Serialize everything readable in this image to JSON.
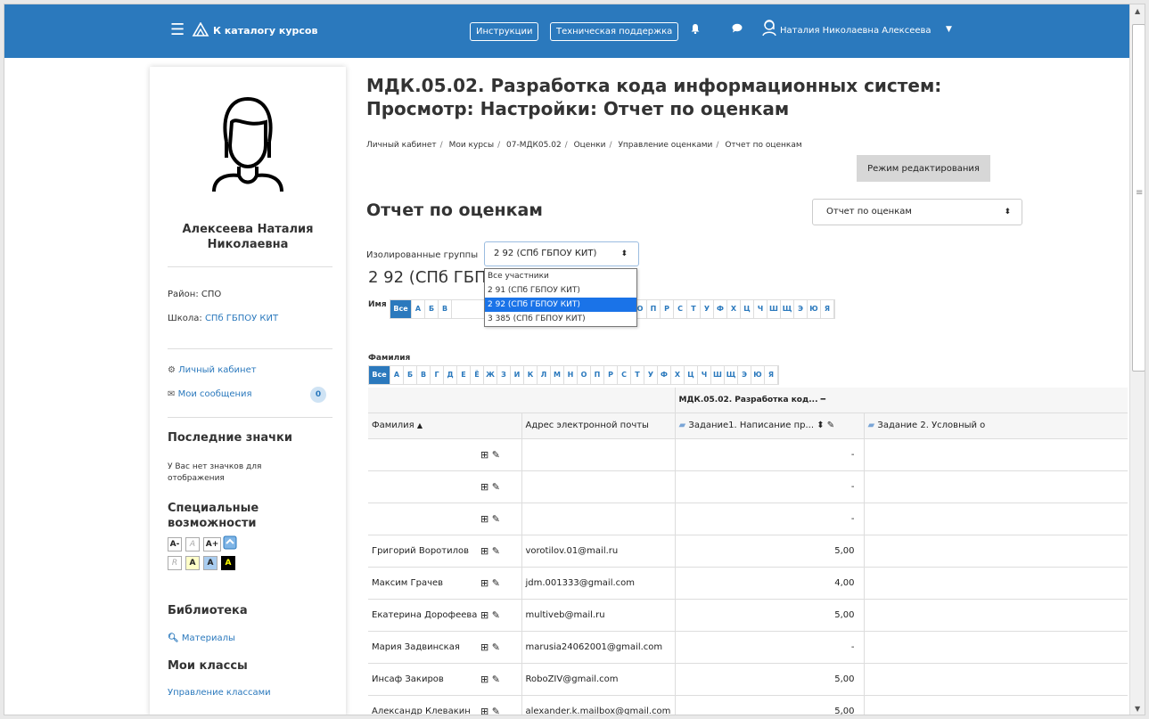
{
  "navbar": {
    "catalog_label": "К каталогу курсов",
    "instructions_label": "Инструкции",
    "support_label": "Техническая поддержка",
    "user_name": "Наталия Николаевна Алексеева",
    "bg_color": "#2b79bd"
  },
  "sidebar": {
    "profile_name": "Алексеева Наталия Николаевна",
    "district_label": "Район:",
    "district_value": "СПО",
    "school_label": "Школа:",
    "school_value": "СПб ГБПОУ КИТ",
    "dashboard_link": "Личный кабинет",
    "messages_link": "Мои сообщения",
    "messages_count": "0",
    "badges_heading": "Последние значки",
    "badges_empty": "У Вас нет значков для отображения",
    "accessibility_heading": "Специальные возможности",
    "accessibility_buttons": [
      "A-",
      "A",
      "A+",
      "R",
      "A",
      "A",
      "A"
    ],
    "library_heading": "Библиотека",
    "materials_link": "Материалы",
    "classes_heading": "Мои классы",
    "manage_classes_link": "Управление классами"
  },
  "main": {
    "title": "МДК.05.02. Разработка кода информационных систем: Просмотр: Настройки: Отчет по оценкам",
    "breadcrumb": [
      "Личный кабинет",
      "Мои курсы",
      "07-МДК05.02",
      "Оценки",
      "Управление оценками",
      "Отчет по оценкам"
    ],
    "edit_mode_button": "Режим редактирования",
    "report_heading": "Отчет по оценкам",
    "report_select_value": "Отчет по оценкам",
    "groups_label": "Изолированные группы",
    "groups_selected": "2 92 (СПб ГБПОУ КИТ)",
    "groups_heading": "2 92 (СПб ГБПОУ КИТ)",
    "group_options": [
      "Все участники",
      "2 91 (СПб ГБПОУ КИТ)",
      "2 92 (СПб ГБПОУ КИТ)",
      "3 385 (СПб ГБПОУ КИТ)"
    ],
    "first_name_label": "Имя",
    "last_name_label": "Фамилия",
    "all_label": "Все",
    "alphabet": [
      "А",
      "Б",
      "В",
      "Г",
      "Д",
      "Е",
      "Ё",
      "Ж",
      "З",
      "И",
      "К",
      "Л",
      "М",
      "Н",
      "О",
      "П",
      "Р",
      "С",
      "Т",
      "У",
      "Ф",
      "Х",
      "Ц",
      "Ч",
      "Ш",
      "Щ",
      "Э",
      "Ю",
      "Я"
    ],
    "first_name_alphabet_visible": [
      "А",
      "Б",
      "В",
      "М",
      "Н",
      "О",
      "П",
      "Р",
      "С",
      "Т",
      "У",
      "Ф",
      "Х",
      "Ц",
      "Ч",
      "Ш",
      "Щ",
      "Э",
      "Ю",
      "Я"
    ]
  },
  "table": {
    "category_header": "МДК.05.02. Разработка код...",
    "col_surname": "Фамилия",
    "col_email": "Адрес электронной почты",
    "col_task1": "Задание1. Написание пр...",
    "col_task2": "Задание 2. Условный о",
    "rows": [
      {
        "name": "",
        "email": "",
        "grade": "-"
      },
      {
        "name": "",
        "email": "",
        "grade": "-"
      },
      {
        "name": "",
        "email": "",
        "grade": "-"
      },
      {
        "name": "Григорий Воротилов",
        "email": "vorotilov.01@mail.ru",
        "grade": "5,00"
      },
      {
        "name": "Максим Грачев",
        "email": "jdm.001333@gmail.com",
        "grade": "4,00"
      },
      {
        "name": "Екатерина Дорофеева",
        "email": "multiveb@mail.ru",
        "grade": "5,00"
      },
      {
        "name": "Мария Задвинская",
        "email": "marusia24062001@gmail.com",
        "grade": "-"
      },
      {
        "name": "Инсаф Закиров",
        "email": "RoboZIV@gmail.com",
        "grade": "5,00"
      },
      {
        "name": "Александр Клевакин",
        "email": "alexander.k.mailbox@gmail.com",
        "grade": "5,00"
      }
    ]
  }
}
